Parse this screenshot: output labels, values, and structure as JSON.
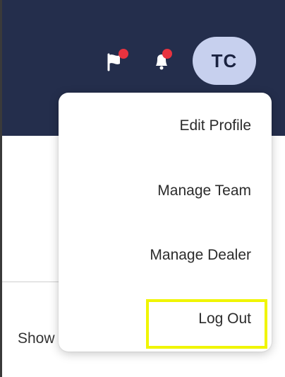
{
  "header": {
    "avatar_initials": "TC",
    "background_color": "#242e4c",
    "icons": [
      {
        "name": "flag-icon",
        "has_notification": true
      },
      {
        "name": "bell-icon",
        "has_notification": true
      }
    ],
    "notification_color": "#e8333f",
    "avatar_color": "#c7d0ee"
  },
  "user_menu": {
    "items": [
      {
        "label": "Edit Profile"
      },
      {
        "label": "Manage Team"
      },
      {
        "label": "Manage Dealer"
      },
      {
        "label": "Log Out",
        "highlighted": true
      }
    ],
    "highlight_color": "#f0f500"
  },
  "page": {
    "show_label_partial": "Show"
  }
}
